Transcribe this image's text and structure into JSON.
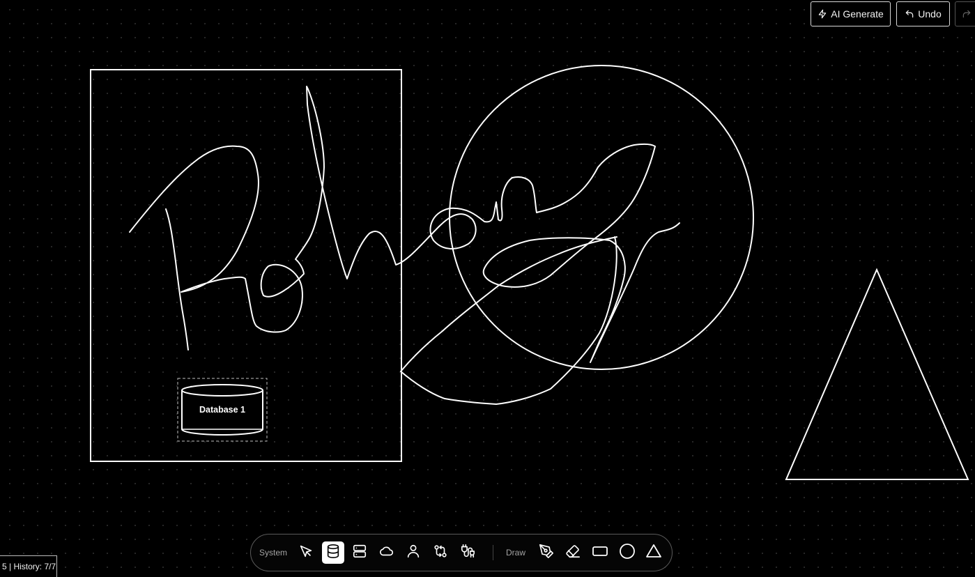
{
  "header": {
    "ai_generate_label": "AI Generate",
    "undo_label": "Undo"
  },
  "canvas": {
    "database_node": {
      "label": "Database 1"
    }
  },
  "toolbar": {
    "system_label": "System",
    "draw_label": "Draw",
    "active_tool": "database",
    "system_tools": [
      "select",
      "database",
      "server",
      "cloud",
      "user",
      "api-connector",
      "plug-connector"
    ],
    "draw_tools": [
      "pen",
      "eraser",
      "rectangle",
      "circle",
      "triangle"
    ]
  },
  "status": {
    "text": "5 | History: 7/7"
  },
  "colors": {
    "background": "#000000",
    "stroke": "#ffffff",
    "grid_dot": "#2a2a2a",
    "toolbar_border": "#5a5a5a"
  }
}
